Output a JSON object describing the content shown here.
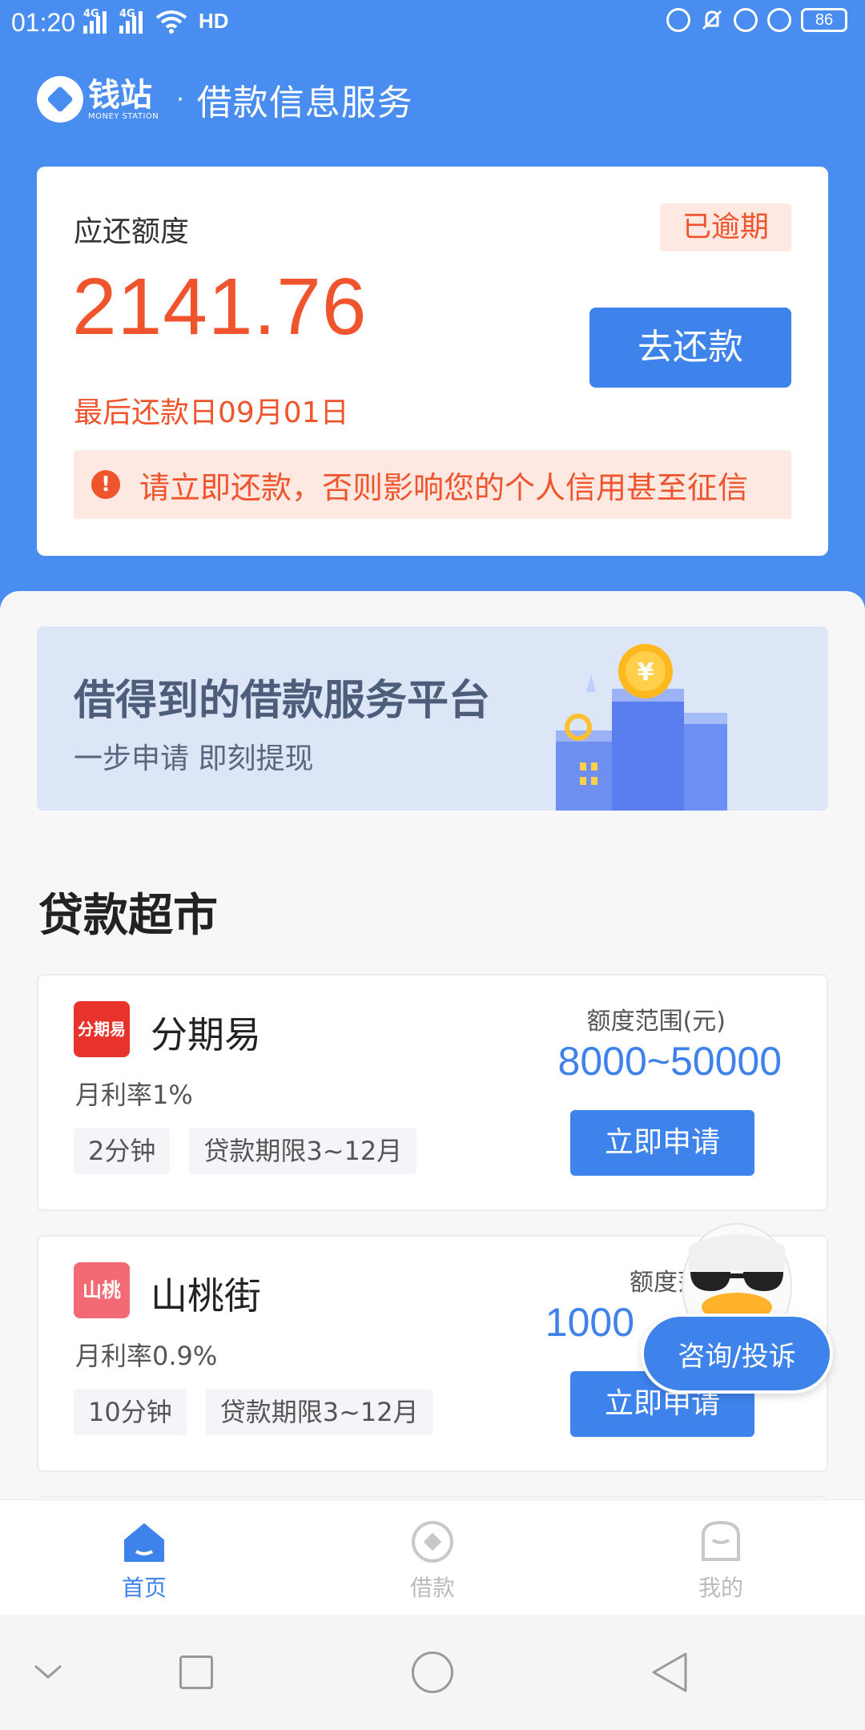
{
  "status_bar": {
    "time": "01:20",
    "network1": "4G",
    "network2": "4G",
    "hd": "HD",
    "battery": "86"
  },
  "brand": {
    "logo_cn": "钱站",
    "logo_en": "MONEY STATION",
    "separator": "·",
    "title": "借款信息服务"
  },
  "repayment": {
    "label": "应还额度",
    "status_badge": "已逾期",
    "amount": "2141.76",
    "button": "去还款",
    "due_date": "最后还款日09月01日",
    "warning": "请立即还款，否则影响您的个人信用甚至征信"
  },
  "banner": {
    "title": "借得到的借款服务平台",
    "subtitle": "一步申请 即刻提现"
  },
  "section_title": "贷款超市",
  "loans": [
    {
      "logo_text": "分期易",
      "name": "分期易",
      "rate": "月利率1%",
      "tags": [
        "2分钟",
        "贷款期限3~12月"
      ],
      "range_label": "额度范围(元)",
      "range": "8000~50000",
      "apply": "立即申请"
    },
    {
      "logo_text": "山桃",
      "name": "山桃街",
      "rate": "月利率0.9%",
      "tags": [
        "10分钟",
        "贷款期限3~12月"
      ],
      "range_label": "额度范围",
      "range": "1000",
      "apply": "立即申请"
    }
  ],
  "floating": {
    "consult": "咨询/投诉"
  },
  "tabs": [
    {
      "label": "首页",
      "icon": "home-icon",
      "active": true
    },
    {
      "label": "借款",
      "icon": "loan-icon",
      "active": false
    },
    {
      "label": "我的",
      "icon": "profile-icon",
      "active": false
    }
  ],
  "colors": {
    "primary": "#3e82ec",
    "header_bg": "#4a8df0",
    "alert": "#f0542c",
    "alert_bg": "#fde8e2"
  }
}
